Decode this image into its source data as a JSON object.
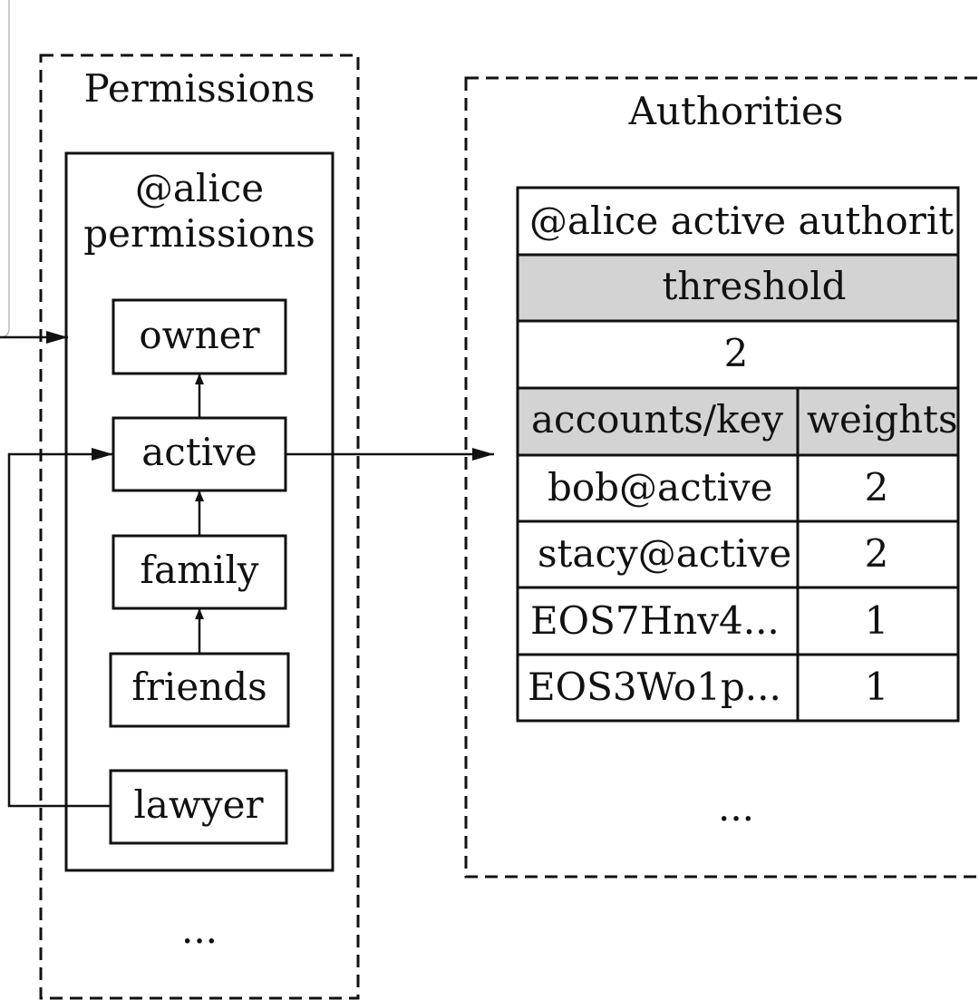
{
  "permissions": {
    "title": "Permissions",
    "group_title_line1": "@alice",
    "group_title_line2": "permissions",
    "items": [
      "owner",
      "active",
      "family",
      "friends",
      "lawyer"
    ],
    "more": "..."
  },
  "authorities": {
    "title": "Authorities",
    "table_title": "@alice active authorit",
    "threshold_label": "threshold",
    "threshold_value": "2",
    "col_accounts": "accounts/key",
    "col_weights": "weights",
    "rows": [
      {
        "account": "bob@active",
        "weight": "2"
      },
      {
        "account": "stacy@active",
        "weight": "2"
      },
      {
        "account": "EOS7Hnv4...",
        "weight": "1"
      },
      {
        "account": "EOS3Wo1p...",
        "weight": "1"
      }
    ],
    "more": "..."
  },
  "colors": {
    "header_fill": "#d3d3d3",
    "stroke": "#111111"
  }
}
